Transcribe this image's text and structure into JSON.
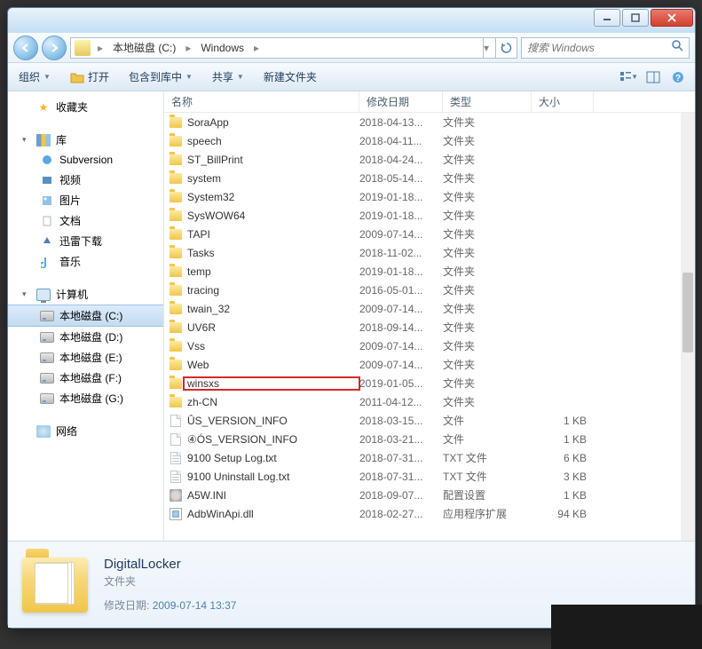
{
  "breadcrumb": {
    "parts": [
      "本地磁盘 (C:)",
      "Windows"
    ]
  },
  "search": {
    "placeholder": "搜索 Windows"
  },
  "toolbar": {
    "organize": "组织",
    "open": "打开",
    "include": "包含到库中",
    "share": "共享",
    "newfolder": "新建文件夹"
  },
  "columns": {
    "name": "名称",
    "date": "修改日期",
    "type": "类型",
    "size": "大小"
  },
  "sidebar": {
    "favorites": "收藏夹",
    "libraries": "库",
    "lib_items": [
      "Subversion",
      "视频",
      "图片",
      "文档",
      "迅雷下载",
      "音乐"
    ],
    "computer": "计算机",
    "drives": [
      "本地磁盘 (C:)",
      "本地磁盘 (D:)",
      "本地磁盘 (E:)",
      "本地磁盘 (F:)",
      "本地磁盘 (G:)"
    ],
    "network": "网络"
  },
  "files": [
    {
      "icon": "folder",
      "name": "SoraApp",
      "date": "2018-04-13...",
      "type": "文件夹",
      "size": ""
    },
    {
      "icon": "folder",
      "name": "speech",
      "date": "2018-04-11...",
      "type": "文件夹",
      "size": ""
    },
    {
      "icon": "folder",
      "name": "ST_BillPrint",
      "date": "2018-04-24...",
      "type": "文件夹",
      "size": ""
    },
    {
      "icon": "folder",
      "name": "system",
      "date": "2018-05-14...",
      "type": "文件夹",
      "size": ""
    },
    {
      "icon": "folder",
      "name": "System32",
      "date": "2019-01-18...",
      "type": "文件夹",
      "size": ""
    },
    {
      "icon": "folder",
      "name": "SysWOW64",
      "date": "2019-01-18...",
      "type": "文件夹",
      "size": ""
    },
    {
      "icon": "folder",
      "name": "TAPI",
      "date": "2009-07-14...",
      "type": "文件夹",
      "size": ""
    },
    {
      "icon": "folder",
      "name": "Tasks",
      "date": "2018-11-02...",
      "type": "文件夹",
      "size": ""
    },
    {
      "icon": "folder",
      "name": "temp",
      "date": "2019-01-18...",
      "type": "文件夹",
      "size": ""
    },
    {
      "icon": "folder",
      "name": "tracing",
      "date": "2016-05-01...",
      "type": "文件夹",
      "size": ""
    },
    {
      "icon": "folder",
      "name": "twain_32",
      "date": "2009-07-14...",
      "type": "文件夹",
      "size": ""
    },
    {
      "icon": "folder",
      "name": "UV6R",
      "date": "2018-09-14...",
      "type": "文件夹",
      "size": ""
    },
    {
      "icon": "folder",
      "name": "Vss",
      "date": "2009-07-14...",
      "type": "文件夹",
      "size": ""
    },
    {
      "icon": "folder",
      "name": "Web",
      "date": "2009-07-14...",
      "type": "文件夹",
      "size": ""
    },
    {
      "icon": "folder",
      "name": "winsxs",
      "date": "2019-01-05...",
      "type": "文件夹",
      "size": "",
      "hl": true
    },
    {
      "icon": "folder",
      "name": "zh-CN",
      "date": "2011-04-12...",
      "type": "文件夹",
      "size": ""
    },
    {
      "icon": "file",
      "name": "ÛS_VERSION_INFO",
      "date": "2018-03-15...",
      "type": "文件",
      "size": "1 KB"
    },
    {
      "icon": "file",
      "name": "④ÓS_VERSION_INFO",
      "date": "2018-03-21...",
      "type": "文件",
      "size": "1 KB"
    },
    {
      "icon": "txt",
      "name": "9100 Setup Log.txt",
      "date": "2018-07-31...",
      "type": "TXT 文件",
      "size": "6 KB"
    },
    {
      "icon": "txt",
      "name": "9100 Uninstall Log.txt",
      "date": "2018-07-31...",
      "type": "TXT 文件",
      "size": "3 KB"
    },
    {
      "icon": "ini",
      "name": "A5W.INI",
      "date": "2018-09-07...",
      "type": "配置设置",
      "size": "1 KB"
    },
    {
      "icon": "dll",
      "name": "AdbWinApi.dll",
      "date": "2018-02-27...",
      "type": "应用程序扩展",
      "size": "94 KB"
    }
  ],
  "details": {
    "name": "DigitalLocker",
    "type": "文件夹",
    "date_label": "修改日期:",
    "date_value": "2009-07-14 13:37"
  }
}
